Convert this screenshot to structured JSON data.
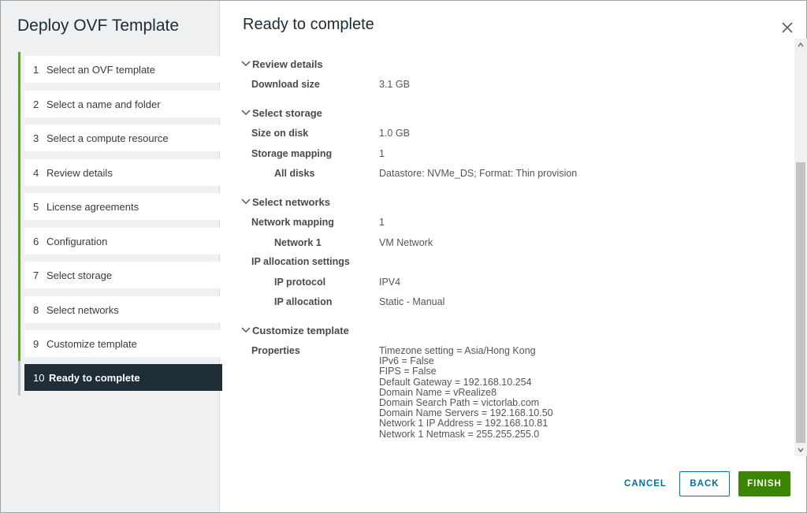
{
  "wizard": {
    "title": "Deploy OVF Template",
    "steps": [
      {
        "num": "1",
        "label": "Select an OVF template"
      },
      {
        "num": "2",
        "label": "Select a name and folder"
      },
      {
        "num": "3",
        "label": "Select a compute resource"
      },
      {
        "num": "4",
        "label": "Review details"
      },
      {
        "num": "5",
        "label": "License agreements"
      },
      {
        "num": "6",
        "label": "Configuration"
      },
      {
        "num": "7",
        "label": "Select storage"
      },
      {
        "num": "8",
        "label": "Select networks"
      },
      {
        "num": "9",
        "label": "Customize template"
      },
      {
        "num": "10",
        "label": "Ready to complete"
      }
    ],
    "active_step": "10"
  },
  "main": {
    "title": "Ready to complete",
    "sections": {
      "review_details": {
        "heading": "Review details",
        "download_size_label": "Download size",
        "download_size_value": "3.1 GB"
      },
      "select_storage": {
        "heading": "Select storage",
        "size_on_disk_label": "Size on disk",
        "size_on_disk_value": "1.0 GB",
        "storage_mapping_label": "Storage mapping",
        "storage_mapping_value": "1",
        "all_disks_label": "All disks",
        "all_disks_value": "Datastore: NVMe_DS; Format: Thin provision"
      },
      "select_networks": {
        "heading": "Select networks",
        "network_mapping_label": "Network mapping",
        "network_mapping_value": "1",
        "network1_label": "Network 1",
        "network1_value": "VM Network",
        "ip_alloc_settings_label": "IP allocation settings",
        "ip_protocol_label": "IP protocol",
        "ip_protocol_value": "IPV4",
        "ip_allocation_label": "IP allocation",
        "ip_allocation_value": "Static - Manual"
      },
      "customize_template": {
        "heading": "Customize template",
        "properties_label": "Properties",
        "properties": [
          "Timezone setting = Asia/Hong Kong",
          "IPv6 = False",
          "FIPS = False",
          "Default Gateway = 192.168.10.254",
          "Domain Name = vRealize8",
          "Domain Search Path = victorlab.com",
          "Domain Name Servers = 192.168.10.50",
          "Network 1 IP Address = 192.168.10.81",
          "Network 1 Netmask = 255.255.255.0"
        ]
      }
    }
  },
  "footer": {
    "cancel_label": "CANCEL",
    "back_label": "BACK",
    "finish_label": "FINISH"
  },
  "icons": {
    "close": "close-icon",
    "chevron": "chevron-down-icon"
  },
  "colors": {
    "accent_green": "#3c8500",
    "progress_green": "#5aa220",
    "link_blue": "#0072a3",
    "active_step_bg": "#1f2d36"
  }
}
